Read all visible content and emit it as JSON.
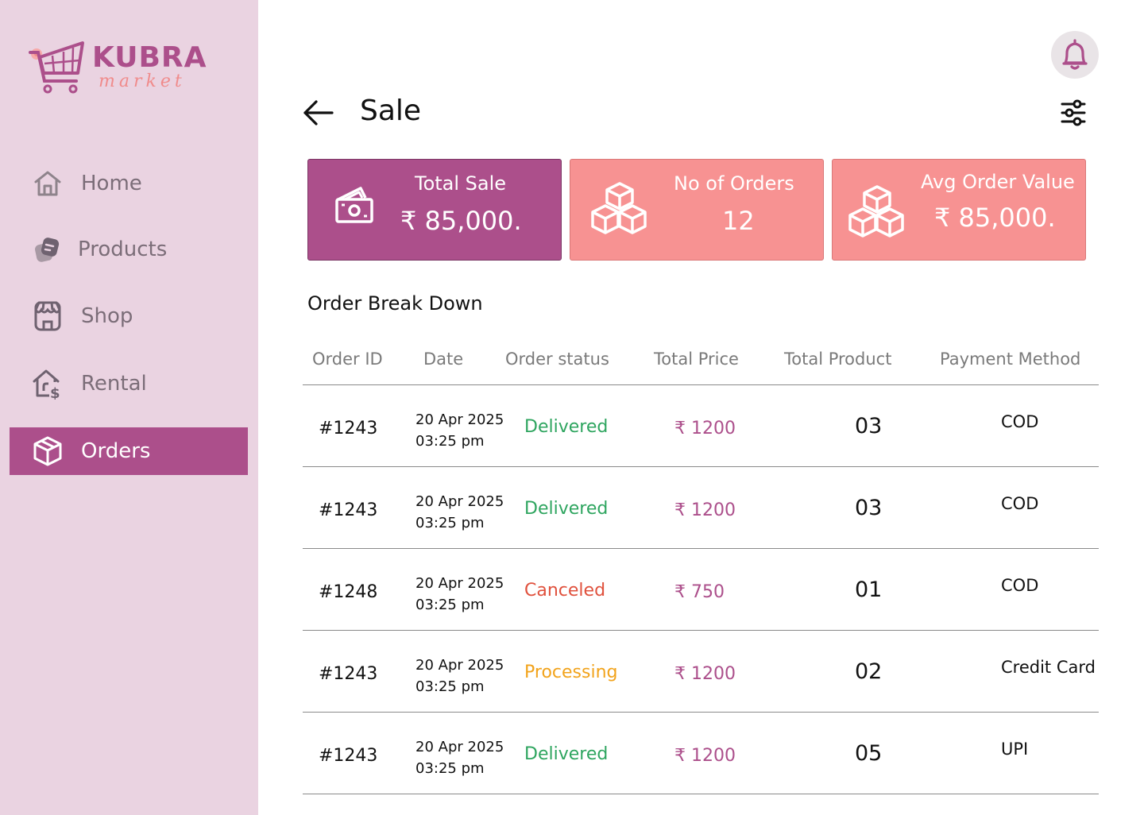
{
  "brand": {
    "name": "KUBRA",
    "sub": "market"
  },
  "sidebar": {
    "items": [
      {
        "label": "Home",
        "icon": "home-icon",
        "active": false
      },
      {
        "label": "Products",
        "icon": "products-icon",
        "active": false
      },
      {
        "label": "Shop",
        "icon": "shop-icon",
        "active": false
      },
      {
        "label": "Rental",
        "icon": "rental-icon",
        "active": false
      },
      {
        "label": "Orders",
        "icon": "orders-icon",
        "active": true
      }
    ]
  },
  "header": {
    "title": "Sale"
  },
  "cards": [
    {
      "label": "Total Sale",
      "value": "₹ 85,000.",
      "icon": "money-icon"
    },
    {
      "label": "No of Orders",
      "value": "12",
      "icon": "boxes-icon"
    },
    {
      "label": "Avg Order Value",
      "value": "₹ 85,000.",
      "icon": "boxes-icon"
    }
  ],
  "breakdown": {
    "title": "Order Break Down",
    "columns": [
      "Order ID",
      "Date",
      "Order status",
      "Total Price",
      "Total Product",
      "Payment Method"
    ],
    "rows": [
      {
        "id": "#1243",
        "date": "20 Apr 2025",
        "time": "03:25 pm",
        "status": "Delivered",
        "price": "₹ 1200",
        "qty": "03",
        "payment": "COD"
      },
      {
        "id": "#1243",
        "date": "20 Apr 2025",
        "time": "03:25 pm",
        "status": "Delivered",
        "price": "₹ 1200",
        "qty": "03",
        "payment": "COD"
      },
      {
        "id": "#1248",
        "date": "20 Apr 2025",
        "time": "03:25 pm",
        "status": "Canceled",
        "price": "₹ 750",
        "qty": "01",
        "payment": "COD"
      },
      {
        "id": "#1243",
        "date": "20 Apr 2025",
        "time": "03:25 pm",
        "status": "Processing",
        "price": "₹ 1200",
        "qty": "02",
        "payment": "Credit Card"
      },
      {
        "id": "#1243",
        "date": "20 Apr 2025",
        "time": "03:25 pm",
        "status": "Delivered",
        "price": "₹ 1200",
        "qty": "05",
        "payment": "UPI"
      }
    ]
  },
  "colors": {
    "accent": "#ac4f8b",
    "card_pink": "#f79292",
    "sidebar_bg": "#ead3e1",
    "delivered": "#2ea55f",
    "canceled": "#e0513d",
    "processing": "#f2a31b"
  }
}
